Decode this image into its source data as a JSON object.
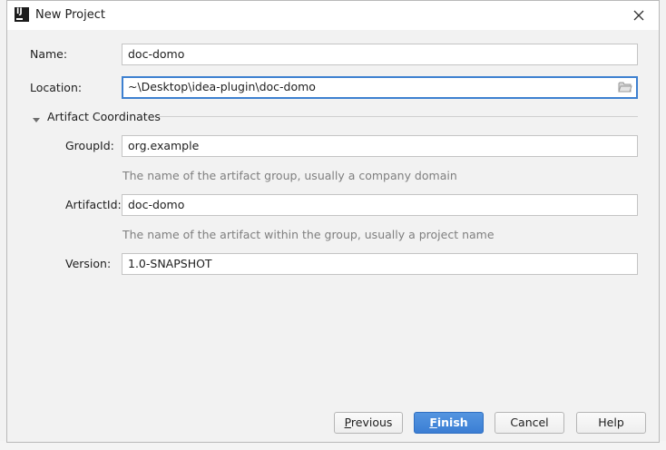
{
  "window": {
    "title": "New Project",
    "close_icon": "close-icon",
    "app_icon": "intellij-icon"
  },
  "form": {
    "name_label": "Name:",
    "name_value": "doc-domo",
    "location_label": "Location:",
    "location_value": "~\\Desktop\\idea-plugin\\doc-domo",
    "browse_icon": "folder-icon"
  },
  "artifact": {
    "section_title": "Artifact Coordinates",
    "expanded": true,
    "groupid_label": "GroupId:",
    "groupid_value": "org.example",
    "groupid_hint": "The name of the artifact group, usually a company domain",
    "artifactid_label": "ArtifactId:",
    "artifactid_value": "doc-domo",
    "artifactid_hint": "The name of the artifact within the group, usually a project name",
    "version_label": "Version:",
    "version_value": "1.0-SNAPSHOT"
  },
  "buttons": {
    "previous_mnemonic": "P",
    "previous_rest": "revious",
    "finish_mnemonic": "F",
    "finish_rest": "inish",
    "cancel": "Cancel",
    "help": "Help"
  },
  "colors": {
    "accent": "#3d80d0",
    "primary_button": "#4a8ad8",
    "hint_text": "#7f7f7f",
    "dialog_bg": "#f2f2f2"
  }
}
